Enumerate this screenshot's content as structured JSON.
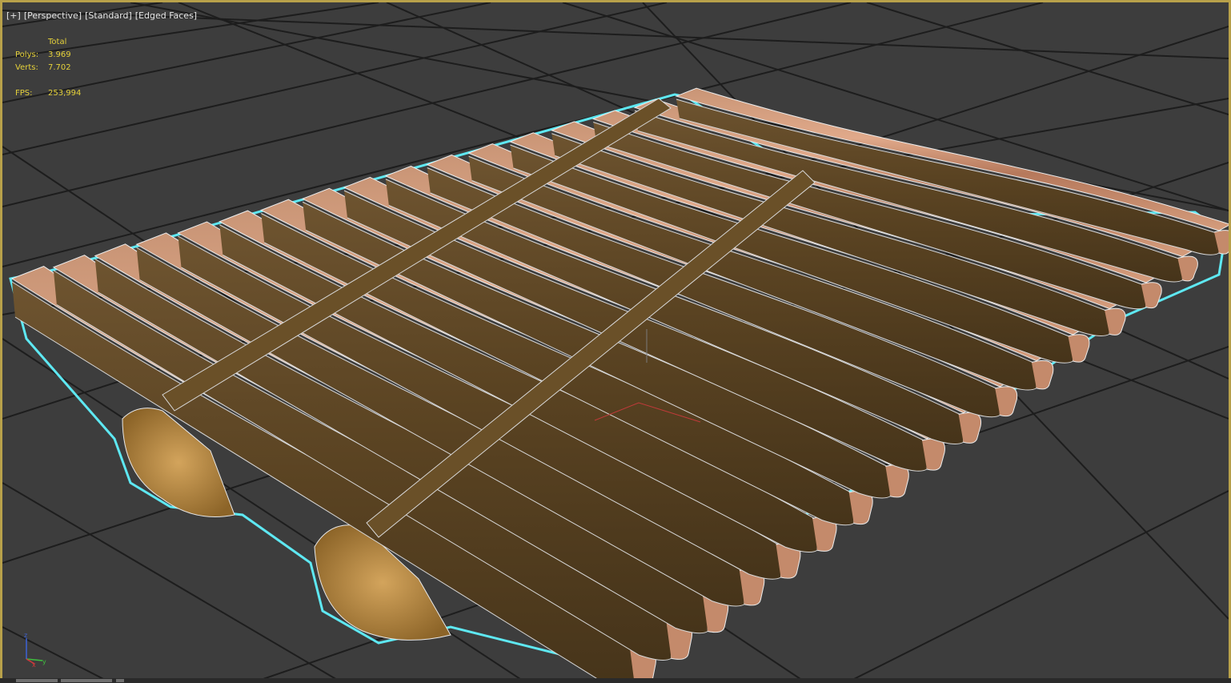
{
  "viewport": {
    "menu": {
      "plus": "[+]",
      "view": "[Perspective]",
      "shading": "[Standard]",
      "edges": "[Edged Faces]"
    },
    "stats": {
      "header": "Total",
      "polys_label": "Polys:",
      "polys_value": "3.969",
      "verts_label": "Verts:",
      "verts_value": "7.702",
      "fps_label": "FPS:",
      "fps_value": "253,994"
    },
    "axis_gizmo": {
      "x": "x",
      "y": "y",
      "z": "z"
    },
    "colors": {
      "background": "#3d3d3d",
      "grid": "#1e1e1e",
      "border": "#b8a14a",
      "selection_outline": "#5ee8f2",
      "wood_light": "#c9906b",
      "wood_dark": "#5a4322",
      "stats_text": "#e5d13a"
    },
    "object": {
      "slat_count": 17,
      "selected": true
    }
  }
}
